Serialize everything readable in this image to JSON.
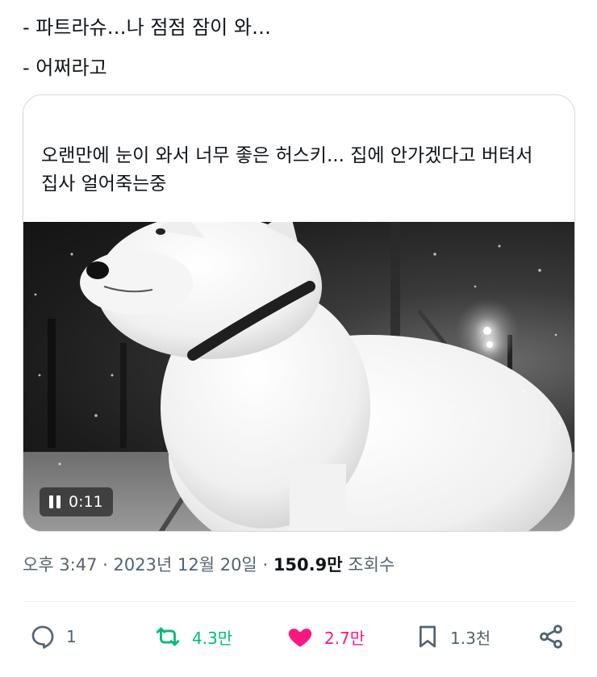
{
  "tweet": {
    "lines": [
      "- 파트라슈…나 점점 잠이 와…",
      "- 어쩌라고"
    ]
  },
  "quoted_card": {
    "text_lines": [
      "오랜만에 눈이 와서 너무 좋은 허스키... 집에 안가겠다고 버텨서",
      "집사 얼어죽는중"
    ],
    "video": {
      "time": "0:11",
      "control_icon": "pause-icon",
      "description_icon": "snow-covered-dog"
    }
  },
  "meta": {
    "time": "오후 3:47",
    "separator": "·",
    "date": "2023년 12월 20일",
    "views_count": "150.9만",
    "views_label": "조회수"
  },
  "actions": {
    "reply": {
      "icon": "reply-icon",
      "count": "1"
    },
    "retweet": {
      "icon": "retweet-icon",
      "count": "4.3만",
      "color": "#00ba7c"
    },
    "like": {
      "icon": "heart-icon",
      "count": "2.7만",
      "color": "#f91880"
    },
    "bookmark": {
      "icon": "bookmark-icon",
      "count": "1.3천"
    },
    "share": {
      "icon": "share-icon"
    }
  }
}
